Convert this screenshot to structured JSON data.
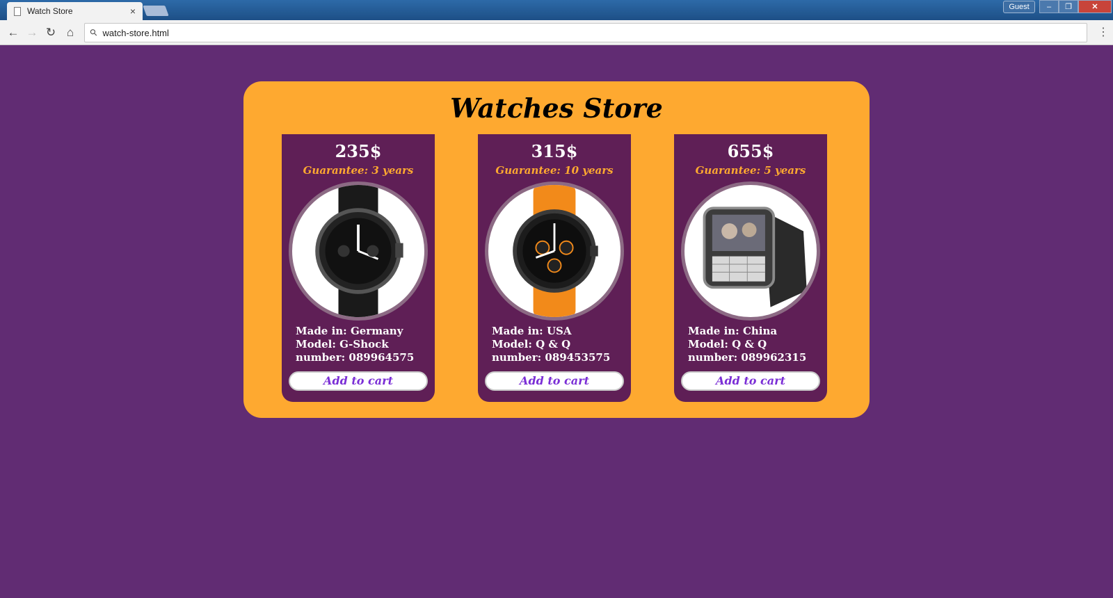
{
  "browser": {
    "tab_title": "Watch Store",
    "tab_close": "×",
    "guest_label": "Guest",
    "address": "watch-store.html",
    "icons": [
      "doc-icon",
      "close-icon",
      "back-icon",
      "forward-icon",
      "reload-icon",
      "home-icon",
      "search-icon",
      "menu-icon",
      "minimize-icon",
      "maximize-icon",
      "window-close-icon"
    ]
  },
  "store": {
    "title": "Watches Store",
    "products": [
      {
        "price": "235$",
        "guarantee": "Guarantee: 3 years",
        "made_in": "Made in: Germany",
        "model": "Model: G-Shock",
        "number": "number: 089964575",
        "button": "Add to cart",
        "strap_color": "#1a1a1a"
      },
      {
        "price": "315$",
        "guarantee": "Guarantee: 10 years",
        "made_in": "Made in: USA",
        "model": "Model: Q & Q",
        "number": "number: 089453575",
        "button": "Add to cart",
        "strap_color": "#f28a1a"
      },
      {
        "price": "655$",
        "guarantee": "Guarantee: 5 years",
        "made_in": "Made in: China",
        "model": "Model: Q & Q",
        "number": "number: 089962315",
        "button": "Add to cart",
        "strap_color": "#2a2a2a"
      }
    ]
  },
  "colors": {
    "background": "#612c73",
    "panel": "#fea930",
    "card": "#5f1f56",
    "accent": "#7b2fd6"
  }
}
